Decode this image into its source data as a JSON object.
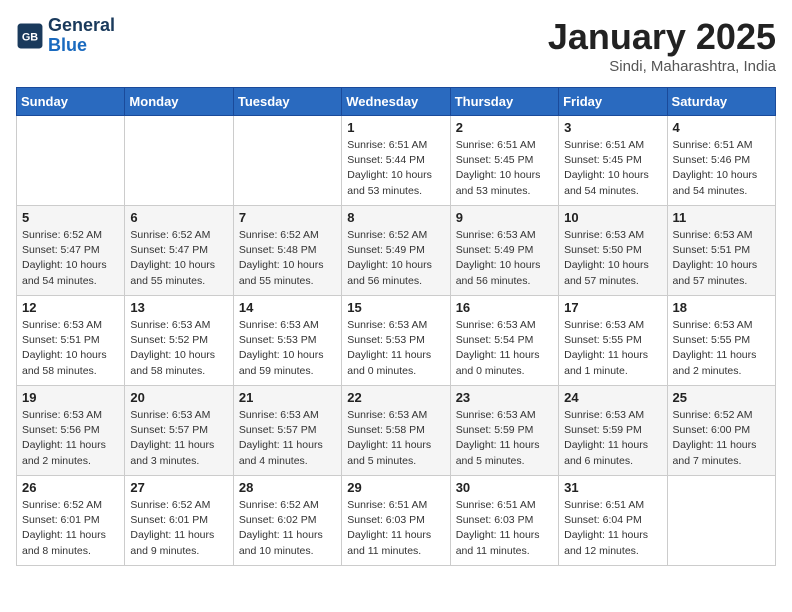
{
  "logo": {
    "line1": "General",
    "line2": "Blue"
  },
  "title": "January 2025",
  "subtitle": "Sindi, Maharashtra, India",
  "weekdays": [
    "Sunday",
    "Monday",
    "Tuesday",
    "Wednesday",
    "Thursday",
    "Friday",
    "Saturday"
  ],
  "weeks": [
    [
      {
        "day": "",
        "info": ""
      },
      {
        "day": "",
        "info": ""
      },
      {
        "day": "",
        "info": ""
      },
      {
        "day": "1",
        "info": "Sunrise: 6:51 AM\nSunset: 5:44 PM\nDaylight: 10 hours\nand 53 minutes."
      },
      {
        "day": "2",
        "info": "Sunrise: 6:51 AM\nSunset: 5:45 PM\nDaylight: 10 hours\nand 53 minutes."
      },
      {
        "day": "3",
        "info": "Sunrise: 6:51 AM\nSunset: 5:45 PM\nDaylight: 10 hours\nand 54 minutes."
      },
      {
        "day": "4",
        "info": "Sunrise: 6:51 AM\nSunset: 5:46 PM\nDaylight: 10 hours\nand 54 minutes."
      }
    ],
    [
      {
        "day": "5",
        "info": "Sunrise: 6:52 AM\nSunset: 5:47 PM\nDaylight: 10 hours\nand 54 minutes."
      },
      {
        "day": "6",
        "info": "Sunrise: 6:52 AM\nSunset: 5:47 PM\nDaylight: 10 hours\nand 55 minutes."
      },
      {
        "day": "7",
        "info": "Sunrise: 6:52 AM\nSunset: 5:48 PM\nDaylight: 10 hours\nand 55 minutes."
      },
      {
        "day": "8",
        "info": "Sunrise: 6:52 AM\nSunset: 5:49 PM\nDaylight: 10 hours\nand 56 minutes."
      },
      {
        "day": "9",
        "info": "Sunrise: 6:53 AM\nSunset: 5:49 PM\nDaylight: 10 hours\nand 56 minutes."
      },
      {
        "day": "10",
        "info": "Sunrise: 6:53 AM\nSunset: 5:50 PM\nDaylight: 10 hours\nand 57 minutes."
      },
      {
        "day": "11",
        "info": "Sunrise: 6:53 AM\nSunset: 5:51 PM\nDaylight: 10 hours\nand 57 minutes."
      }
    ],
    [
      {
        "day": "12",
        "info": "Sunrise: 6:53 AM\nSunset: 5:51 PM\nDaylight: 10 hours\nand 58 minutes."
      },
      {
        "day": "13",
        "info": "Sunrise: 6:53 AM\nSunset: 5:52 PM\nDaylight: 10 hours\nand 58 minutes."
      },
      {
        "day": "14",
        "info": "Sunrise: 6:53 AM\nSunset: 5:53 PM\nDaylight: 10 hours\nand 59 minutes."
      },
      {
        "day": "15",
        "info": "Sunrise: 6:53 AM\nSunset: 5:53 PM\nDaylight: 11 hours\nand 0 minutes."
      },
      {
        "day": "16",
        "info": "Sunrise: 6:53 AM\nSunset: 5:54 PM\nDaylight: 11 hours\nand 0 minutes."
      },
      {
        "day": "17",
        "info": "Sunrise: 6:53 AM\nSunset: 5:55 PM\nDaylight: 11 hours\nand 1 minute."
      },
      {
        "day": "18",
        "info": "Sunrise: 6:53 AM\nSunset: 5:55 PM\nDaylight: 11 hours\nand 2 minutes."
      }
    ],
    [
      {
        "day": "19",
        "info": "Sunrise: 6:53 AM\nSunset: 5:56 PM\nDaylight: 11 hours\nand 2 minutes."
      },
      {
        "day": "20",
        "info": "Sunrise: 6:53 AM\nSunset: 5:57 PM\nDaylight: 11 hours\nand 3 minutes."
      },
      {
        "day": "21",
        "info": "Sunrise: 6:53 AM\nSunset: 5:57 PM\nDaylight: 11 hours\nand 4 minutes."
      },
      {
        "day": "22",
        "info": "Sunrise: 6:53 AM\nSunset: 5:58 PM\nDaylight: 11 hours\nand 5 minutes."
      },
      {
        "day": "23",
        "info": "Sunrise: 6:53 AM\nSunset: 5:59 PM\nDaylight: 11 hours\nand 5 minutes."
      },
      {
        "day": "24",
        "info": "Sunrise: 6:53 AM\nSunset: 5:59 PM\nDaylight: 11 hours\nand 6 minutes."
      },
      {
        "day": "25",
        "info": "Sunrise: 6:52 AM\nSunset: 6:00 PM\nDaylight: 11 hours\nand 7 minutes."
      }
    ],
    [
      {
        "day": "26",
        "info": "Sunrise: 6:52 AM\nSunset: 6:01 PM\nDaylight: 11 hours\nand 8 minutes."
      },
      {
        "day": "27",
        "info": "Sunrise: 6:52 AM\nSunset: 6:01 PM\nDaylight: 11 hours\nand 9 minutes."
      },
      {
        "day": "28",
        "info": "Sunrise: 6:52 AM\nSunset: 6:02 PM\nDaylight: 11 hours\nand 10 minutes."
      },
      {
        "day": "29",
        "info": "Sunrise: 6:51 AM\nSunset: 6:03 PM\nDaylight: 11 hours\nand 11 minutes."
      },
      {
        "day": "30",
        "info": "Sunrise: 6:51 AM\nSunset: 6:03 PM\nDaylight: 11 hours\nand 11 minutes."
      },
      {
        "day": "31",
        "info": "Sunrise: 6:51 AM\nSunset: 6:04 PM\nDaylight: 11 hours\nand 12 minutes."
      },
      {
        "day": "",
        "info": ""
      }
    ]
  ]
}
